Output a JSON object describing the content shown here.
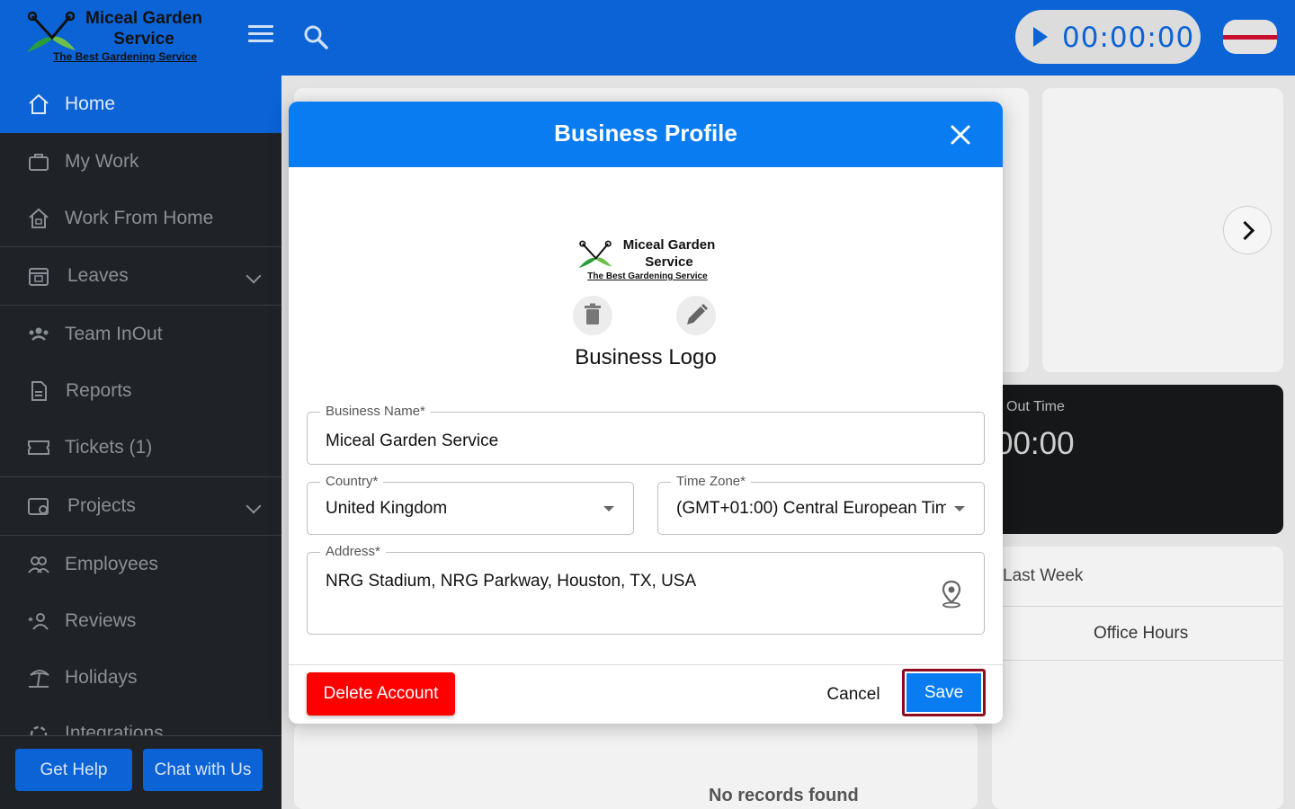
{
  "header": {
    "brand_line1": "Miceal Garden",
    "brand_line2": "Service",
    "brand_tagline": "The Best Gardening Service",
    "timer": "00:00:00",
    "menu_icon": "hamburger-icon",
    "search_icon": "search-icon",
    "play_icon": "play-icon"
  },
  "sidebar": {
    "items": [
      {
        "label": "Home",
        "icon": "home-icon"
      },
      {
        "label": "My Work",
        "icon": "briefcase-icon"
      },
      {
        "label": "Work From Home",
        "icon": "home-work-icon"
      },
      {
        "label": "Leaves",
        "icon": "calendar-icon"
      },
      {
        "label": "Team InOut",
        "icon": "team-icon"
      },
      {
        "label": "Reports",
        "icon": "report-icon"
      },
      {
        "label": "Tickets (1)",
        "icon": "ticket-icon"
      },
      {
        "label": "Projects",
        "icon": "projects-icon"
      },
      {
        "label": "Employees",
        "icon": "employees-icon"
      },
      {
        "label": "Reviews",
        "icon": "reviews-icon"
      },
      {
        "label": "Holidays",
        "icon": "holiday-icon"
      },
      {
        "label": "Integrations",
        "icon": "integrations-icon"
      }
    ],
    "get_help": "Get Help",
    "chat": "Chat with Us"
  },
  "background": {
    "out_time_label": "Out Time",
    "out_time_value": "00:00",
    "last_week": "Last Week",
    "office_hours": "Office Hours",
    "no_records": "No records found"
  },
  "modal": {
    "title": "Business Profile",
    "logo_line1": "Miceal Garden",
    "logo_line2": "Service",
    "logo_tagline": "The Best Gardening Service",
    "logo_label": "Business Logo",
    "business_name_label": "Business Name*",
    "business_name_value": "Miceal Garden Service",
    "country_label": "Country*",
    "country_value": "United Kingdom",
    "timezone_label": "Time Zone*",
    "timezone_value": "(GMT+01:00) Central European Tim...",
    "address_label": "Address*",
    "address_value": "NRG Stadium, NRG Parkway, Houston, TX, USA",
    "delete_button": "Delete Account",
    "cancel_button": "Cancel",
    "save_button": "Save"
  },
  "colors": {
    "header_blue": "#0b63d6",
    "modal_blue": "#0a7cf2",
    "delete_red": "#fe0000",
    "save_outline": "#8b0d1e",
    "sidebar_dark": "#1f2327"
  }
}
